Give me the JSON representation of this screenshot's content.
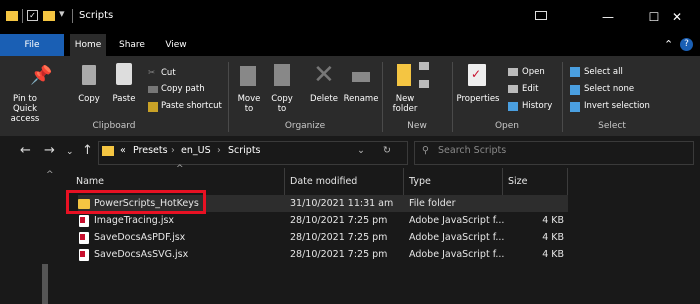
{
  "window": {
    "title": "Scripts",
    "min_glyph": "—",
    "max_glyph": "☐",
    "close_glyph": "✕"
  },
  "ribbon_tabs": [
    "File",
    "Home",
    "Share",
    "View"
  ],
  "ribbon_groups": {
    "clipboard": {
      "label": "Clipboard",
      "pin": "Pin to Quick\naccess",
      "copy": "Copy",
      "paste": "Paste",
      "cut": "Cut",
      "copy_path": "Copy path",
      "paste_shortcut": "Paste shortcut"
    },
    "organize": {
      "label": "Organize",
      "move_to": "Move\nto",
      "copy_to": "Copy\nto",
      "delete": "Delete",
      "rename": "Rename"
    },
    "new": {
      "label": "New",
      "new_folder": "New\nfolder"
    },
    "open": {
      "label": "Open",
      "properties": "Properties",
      "open": "Open",
      "edit": "Edit",
      "history": "History"
    },
    "select": {
      "label": "Select",
      "select_all": "Select all",
      "select_none": "Select none",
      "invert_selection": "Invert selection"
    }
  },
  "address": {
    "crumbs": [
      "Presets",
      "en_US",
      "Scripts"
    ],
    "overflow": "«",
    "search_placeholder": "Search Scripts"
  },
  "columns": [
    "Name",
    "Date modified",
    "Type",
    "Size"
  ],
  "files": [
    {
      "name": "PowerScripts_HotKeys",
      "date": "31/10/2021 11:31 am",
      "type": "File folder",
      "size": "",
      "icon": "folder-icon"
    },
    {
      "name": "ImageTracing.jsx",
      "date": "28/10/2021 7:25 pm",
      "type": "Adobe JavaScript f...",
      "size": "4 KB",
      "icon": "jsx-file-icon"
    },
    {
      "name": "SaveDocsAsPDF.jsx",
      "date": "28/10/2021 7:25 pm",
      "type": "Adobe JavaScript f...",
      "size": "4 KB",
      "icon": "jsx-file-icon"
    },
    {
      "name": "SaveDocsAsSVG.jsx",
      "date": "28/10/2021 7:25 pm",
      "type": "Adobe JavaScript f...",
      "size": "4 KB",
      "icon": "jsx-file-icon"
    }
  ],
  "colors": {
    "accent": "#1a5fb4",
    "highlight_border": "#e81123",
    "folder": "#f4c542"
  }
}
